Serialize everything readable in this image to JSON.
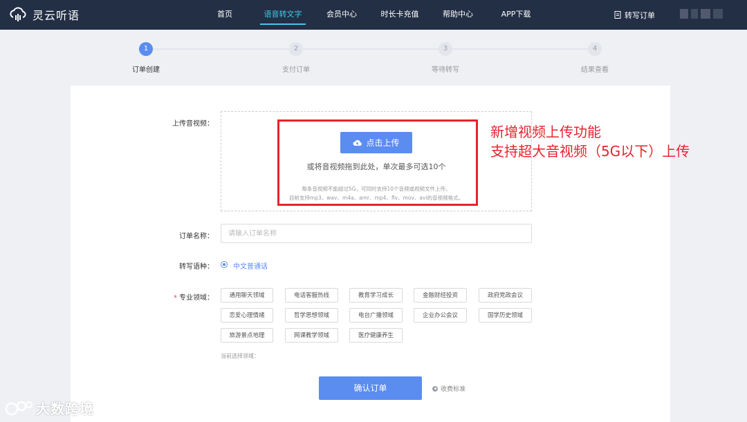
{
  "brand": {
    "name": "灵云听语",
    "icon": "cloud-logo-icon"
  },
  "nav": [
    {
      "label": "首页",
      "active": false
    },
    {
      "label": "语音转文字",
      "active": true
    },
    {
      "label": "会员中心",
      "active": false
    },
    {
      "label": "时长卡充值",
      "active": false
    },
    {
      "label": "帮助中心",
      "active": false
    },
    {
      "label": "APP下载",
      "active": false
    }
  ],
  "order_link": {
    "label": "转写订单",
    "icon": "document-icon"
  },
  "steps": [
    {
      "num": "1",
      "label": "订单创建",
      "active": true
    },
    {
      "num": "2",
      "label": "支付订单",
      "active": false
    },
    {
      "num": "3",
      "label": "等待转写",
      "active": false
    },
    {
      "num": "4",
      "label": "结果查看",
      "active": false
    }
  ],
  "upload": {
    "label": "上传音视频：",
    "button_label": "点击上传",
    "button_icon": "cloud-upload-icon",
    "drag_text": "或将音视频拖到此处，单次最多可选10个",
    "hint_line1": "每条音视频不能超过5G，可同时支持10个音频或视频文件上传。",
    "hint_line2": "目前支持mp3、wav、m4a、amr、mp4、flv、mov、avi的音视频格式。"
  },
  "annotation": {
    "line1": "新增视频上传功能",
    "line2": "支持超大音视频（5G以下）上传"
  },
  "order_name": {
    "label": "订单名称：",
    "value": "",
    "placeholder": "请输入订单名称"
  },
  "language": {
    "label": "转写语种：",
    "option": "中文普通话",
    "selected": true
  },
  "domain": {
    "required_mark": "*",
    "label": "专业领域：",
    "tags": [
      "通用聊天领域",
      "电话客服热线",
      "教育学习成长",
      "金融财经投资",
      "政府党政会议",
      "恋爱心理情绪",
      "哲学思想领域",
      "电台广播领域",
      "企业办公会议",
      "国学历史领域",
      "旅游景点地理",
      "网课教学领域",
      "医疗健康养生"
    ],
    "current_label": "当前选择领域："
  },
  "confirm": {
    "label": "确认订单"
  },
  "fee": {
    "label": "收费标准"
  },
  "watermark": {
    "text": "大数跨境"
  },
  "colors": {
    "topbar": "#232f45",
    "nav_active": "#45c7e6",
    "primary": "#5b8cf0",
    "annotation_red": "#e8222c",
    "page_bg": "#eef0f4"
  }
}
